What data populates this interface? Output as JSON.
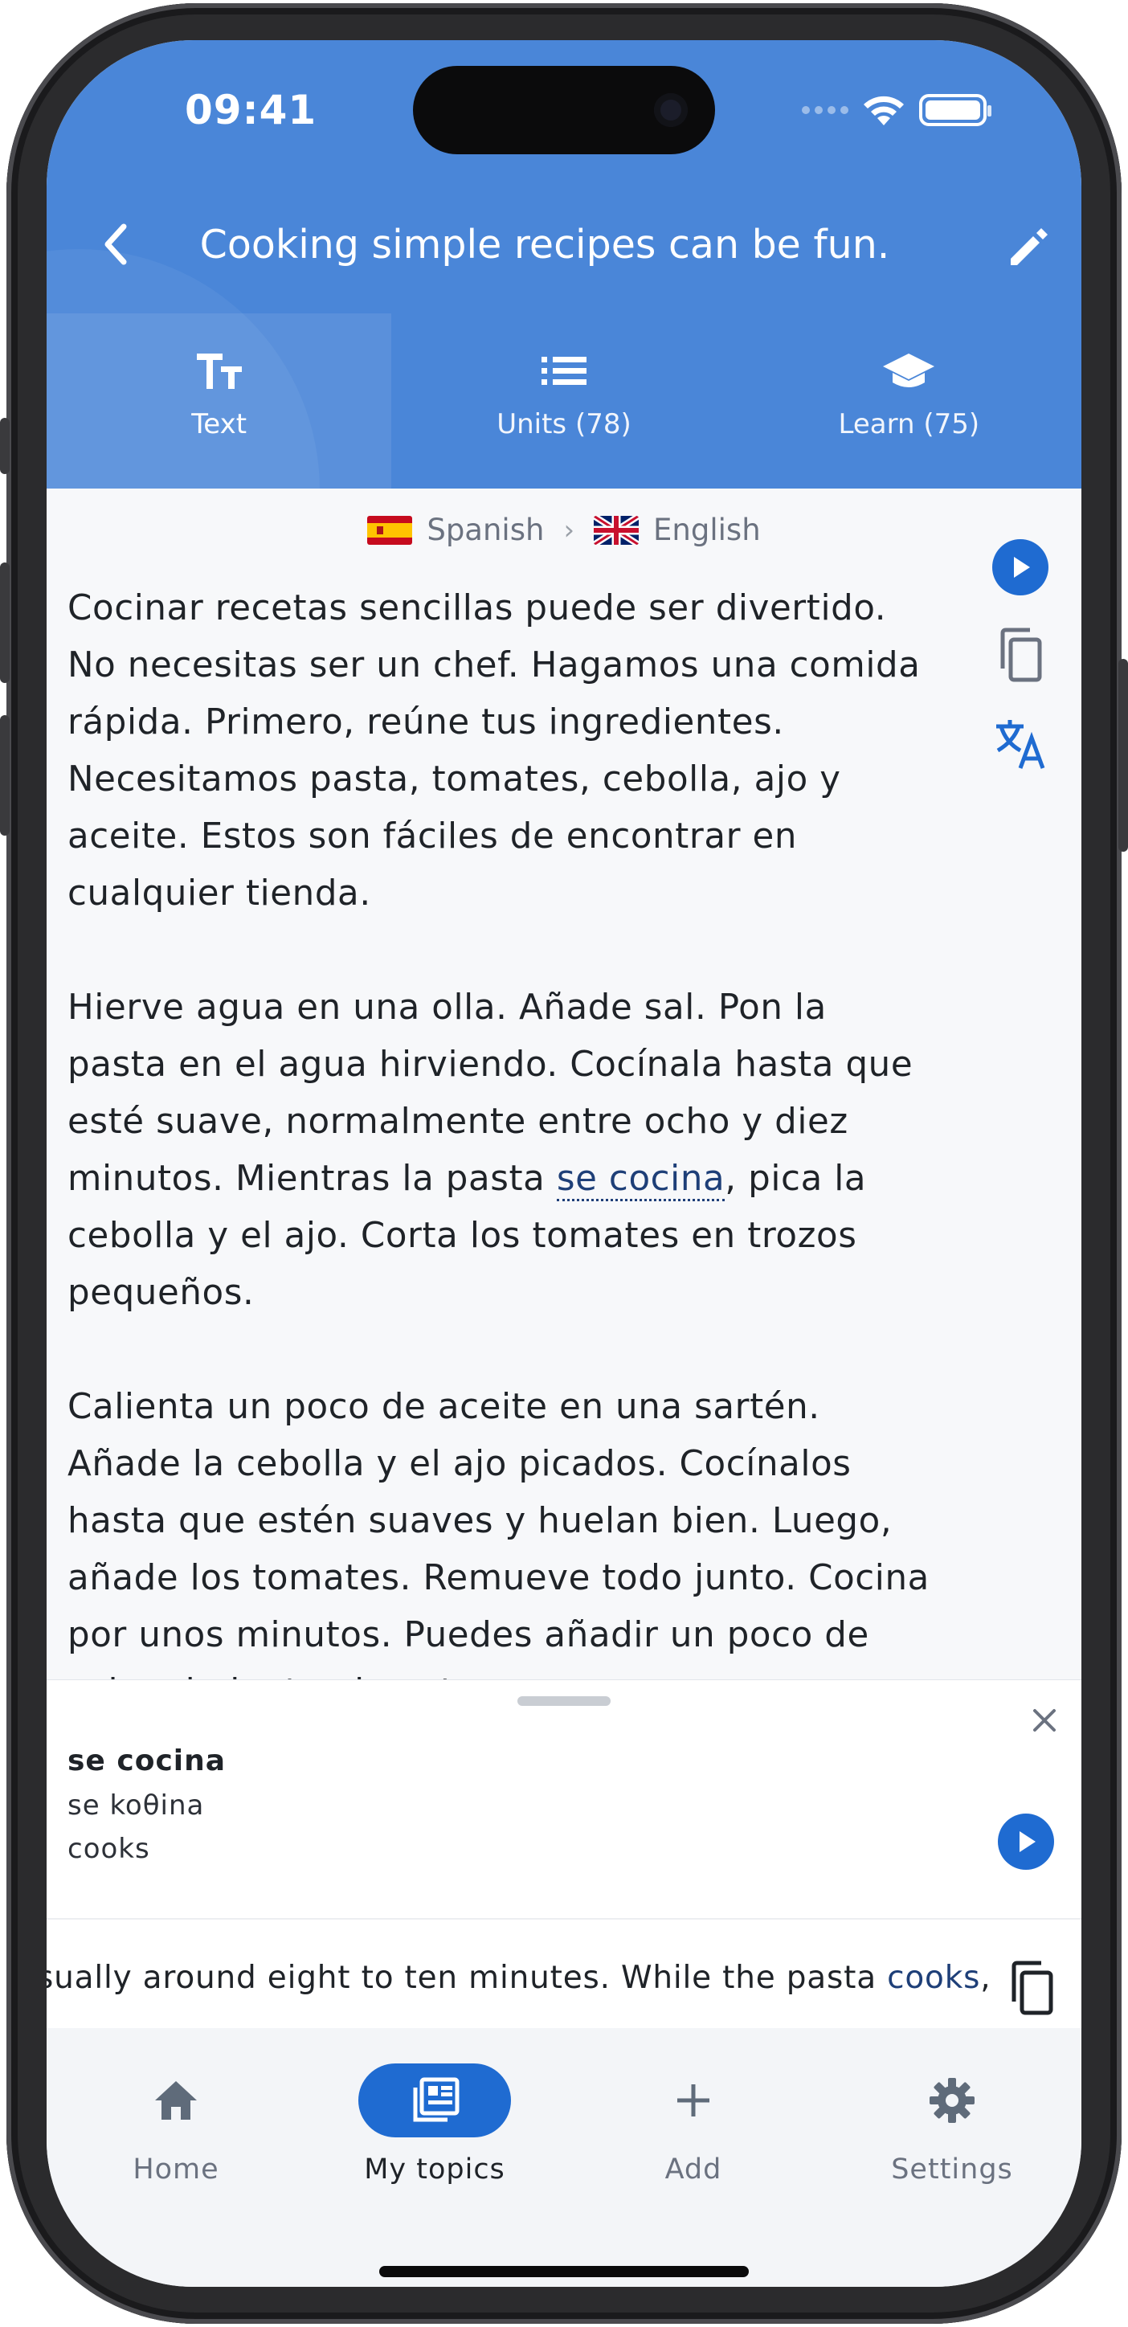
{
  "status_bar": {
    "time": "09:41"
  },
  "header": {
    "title": "Cooking simple recipes can be fun.",
    "back_icon": "chevron-left-icon",
    "edit_icon": "pencil-icon",
    "background_color": "#4a86d8"
  },
  "tabs": [
    {
      "label": "Text",
      "icon": "text-size-icon",
      "active": true
    },
    {
      "label": "Units (78)",
      "icon": "list-icon",
      "active": false
    },
    {
      "label": "Learn (75)",
      "icon": "graduation-cap-icon",
      "active": false
    }
  ],
  "languages": {
    "source": "Spanish",
    "target": "English"
  },
  "reading": {
    "p1": "Cocinar recetas sencillas puede ser divertido.\nNo necesitas ser un chef. Hagamos una comida\nrápida. Primero, reúne tus ingredientes.\nNecesitamos pasta, tomates, cebolla, ajo y\naceite. Estos son fáciles de encontrar en\ncualquier tienda.",
    "p2_before": "Hierve agua en una olla. Añade sal. Pon la\npasta en el agua hirviendo. Cocínala hasta que\nesté suave, normalmente entre ocho y diez\nminutos. Mientras la pasta ",
    "p2_highlight": "se cocina",
    "p2_after": ", pica la\ncebolla y el ajo. Corta los tomates en trozos\npequeños.",
    "p3": "Calienta un poco de aceite en una sartén.\nAñade la cebolla y el ajo picados. Cocínalos\nhasta que estén suaves y huelan bien. Luego,\nañade los tomates. Remueve todo junto. Cocina\npor unos minutos. Puedes añadir un poco de\nsal y pimienta al gusto."
  },
  "side_actions": [
    "play-icon",
    "copy-icon",
    "translate-icon"
  ],
  "word_sheet": {
    "term": "se cocina",
    "phonetic": "se koθina",
    "translation": "cooks",
    "sentence_before": "sually around eight to ten minutes. While the pasta ",
    "sentence_highlight": "cooks",
    "sentence_after": ", c"
  },
  "bottom_nav": [
    {
      "label": "Home",
      "icon": "home-icon",
      "active": false
    },
    {
      "label": "My topics",
      "icon": "topics-icon",
      "active": true
    },
    {
      "label": "Add",
      "icon": "plus-icon",
      "active": false
    },
    {
      "label": "Settings",
      "icon": "gear-icon",
      "active": false
    }
  ],
  "colors": {
    "accent": "#1f6bd1",
    "header": "#4a86d8",
    "text": "#1f2328",
    "muted": "#6b7280"
  }
}
